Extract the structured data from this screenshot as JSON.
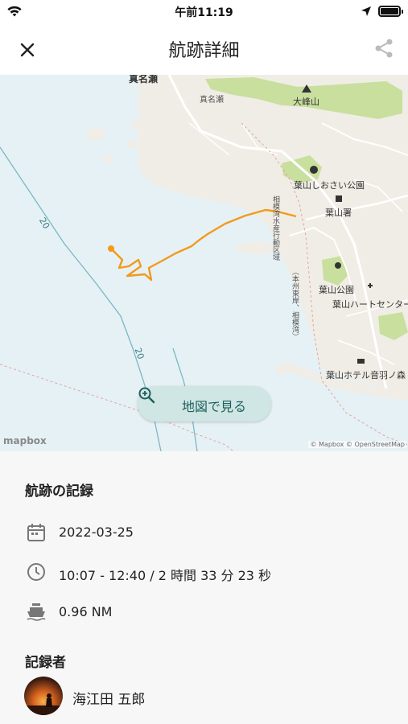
{
  "status_bar": {
    "time": "午前11:19"
  },
  "nav": {
    "title": "航跡詳細"
  },
  "map": {
    "labels": {
      "top_edge": "真名瀬",
      "manase": "真名瀬",
      "oomine": "大峰山",
      "osai_park": "葉山しおさい公園",
      "police": "葉山署",
      "hayama_park": "葉山公園",
      "heart_center": "葉山ハートセンター",
      "hotel": "葉山ホテル音羽ノ森",
      "depth_1": "20",
      "depth_2": "20",
      "road_vertical": "相模湾水産行動区域",
      "road_vertical_2": "（本州東岸、相模湾）"
    },
    "button_label": "地図で見る",
    "logo": "mapbox",
    "attribution": "© Mapbox © OpenStreetMap",
    "colors": {
      "sea": "#e6f1f5",
      "land": "#f0ede6",
      "park": "#c9df9e",
      "track": "#f29a1b"
    }
  },
  "details": {
    "section_title": "航跡の記録",
    "date": "2022-03-25",
    "time_range": "10:07 - 12:40 / 2 時間 33 分 23 秒",
    "distance": "0.96 NM",
    "recorder_title": "記録者",
    "recorder_name": "海江田 五郎"
  }
}
